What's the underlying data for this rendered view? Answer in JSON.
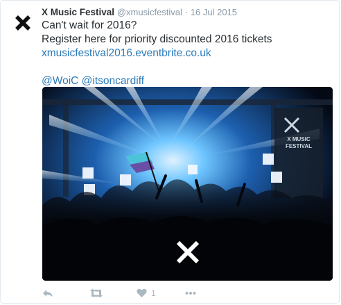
{
  "tweet": {
    "author_name": "X Music Festival",
    "author_handle": "@xmusicfestival",
    "separator": "·",
    "timestamp": "16 Jul 2015",
    "line1": "Can't wait for 2016?",
    "line2": "Register here for priority discounted 2016 tickets",
    "link": "xmusicfestival2016.eventbrite.co.uk",
    "mention1": "@WoiC",
    "mention2": "@itsoncardiff",
    "banner_text_1": "X MUSIC",
    "banner_text_2": "FESTIVAL",
    "media_description_icon": "photo-stage-concert"
  },
  "actions": {
    "reply_icon": "reply-icon",
    "retweet_icon": "retweet-icon",
    "like_icon": "heart-icon",
    "like_count": "1",
    "more_icon": "more-icon"
  },
  "colors": {
    "link": "#2b7bb9",
    "text": "#292f33",
    "muted": "#8899a6",
    "action_icon": "#aab8c2"
  }
}
